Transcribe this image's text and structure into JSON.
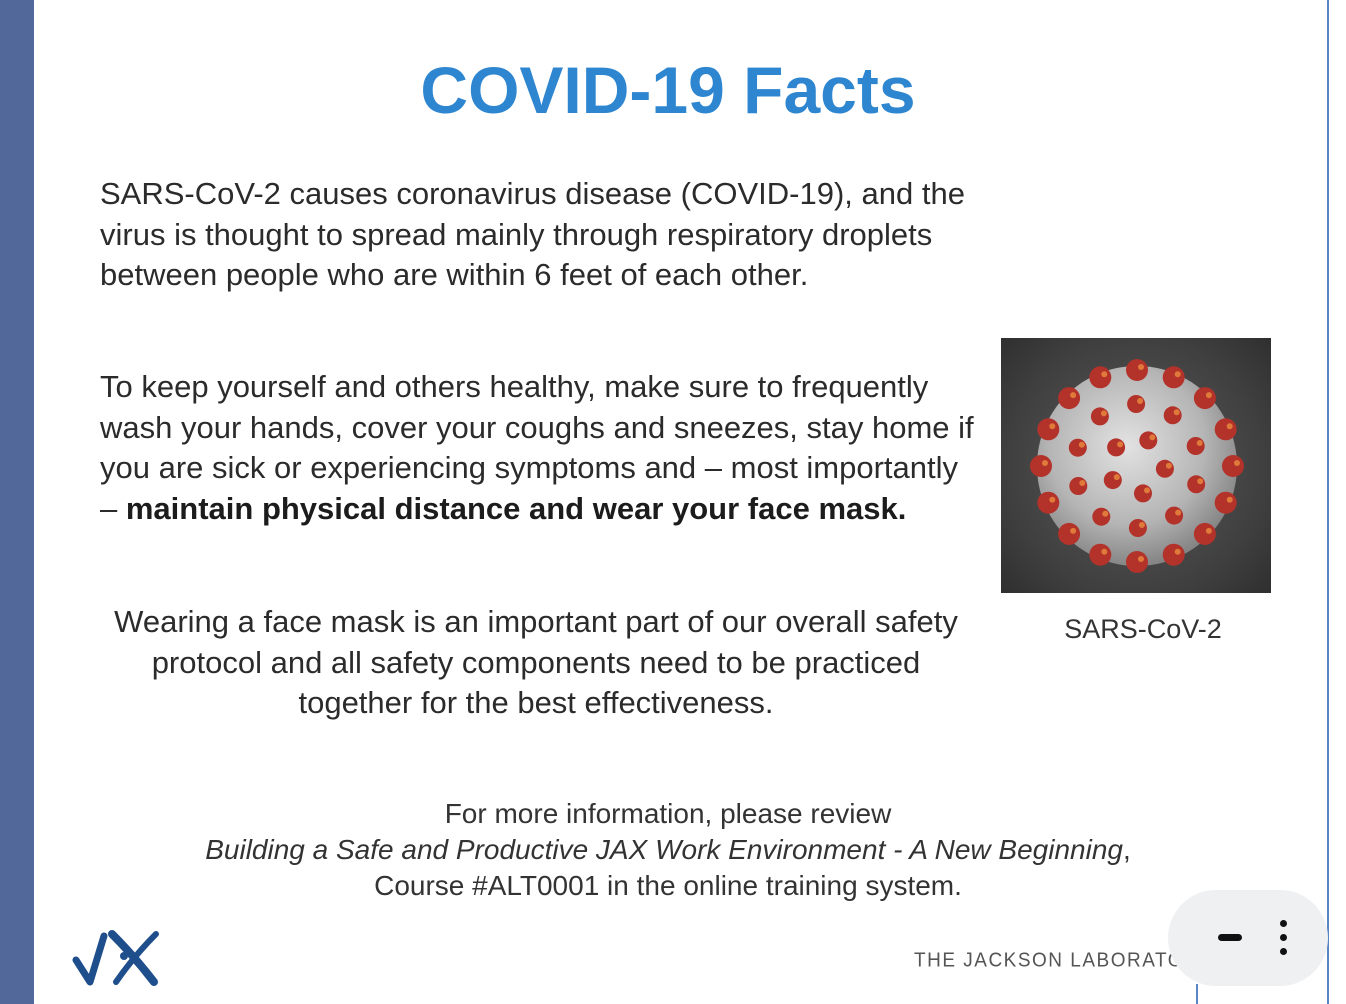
{
  "slide": {
    "title": "COVID-19 Facts",
    "paragraph1": "SARS-CoV-2 causes coronavirus disease (COVID-19), and the virus is thought to spread mainly through respiratory droplets between people who are within 6 feet of each other.",
    "paragraph2_text": "To keep yourself and others healthy, make sure to frequently wash your hands, cover your coughs and sneezes, stay home if you are sick or experiencing symptoms and – most importantly – ",
    "paragraph2_bold": "maintain physical distance and wear your face mask.",
    "paragraph3": "Wearing a face mask is an important part of our overall safety protocol and all safety components need to be practiced together for the best effectiveness.",
    "image_caption": "SARS-CoV-2",
    "info_line1": "For more information, please review",
    "info_course_title": "Building a Safe and Productive JAX Work Environment - A New Beginning",
    "info_line2_suffix": ",",
    "info_line3": "Course #ALT0001 in the online training system.",
    "lab_name": "THE JACKSON LABORATORY",
    "logo_icon": "jax-logo"
  },
  "controls": {
    "minimize_icon": "minimize-icon",
    "more_icon": "more-vertical-icon"
  },
  "colors": {
    "title": "#2e86d0",
    "left_bar": "#52689a",
    "logo": "#1f4e8c"
  }
}
